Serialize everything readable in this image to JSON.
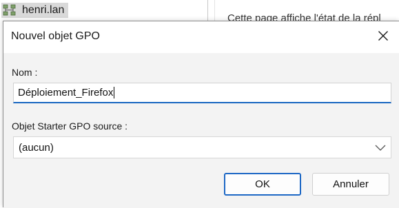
{
  "background": {
    "tree_node_label": "henri.lan",
    "right_panel_text": "Cette page affiche l'état de la répl"
  },
  "dialog": {
    "title": "Nouvel objet GPO",
    "name_label": "Nom :",
    "name_value": "Déploiement_Firefox",
    "starter_label": "Objet Starter GPO source :",
    "starter_selected": "(aucun)",
    "ok_label": "OK",
    "cancel_label": "Annuler"
  },
  "colors": {
    "accent": "#1c67c5",
    "dialog_bg": "#f3f3f3",
    "title_bg": "#ffffff"
  },
  "icons": {
    "domain": "domain-tree-icon",
    "close": "close-icon",
    "dropdown": "chevron-down-icon"
  }
}
